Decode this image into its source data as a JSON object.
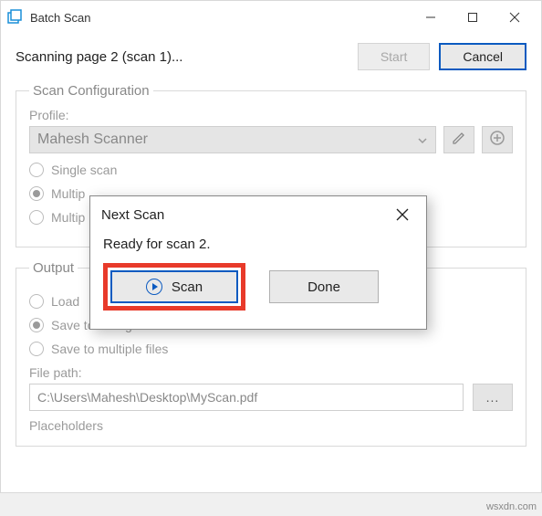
{
  "window": {
    "title": "Batch Scan"
  },
  "status": "Scanning page 2 (scan 1)...",
  "buttons": {
    "start": "Start",
    "cancel": "Cancel"
  },
  "config": {
    "legend": "Scan Configuration",
    "profile_label": "Profile:",
    "profile_value": "Mahesh Scanner",
    "radio_single": "Single scan",
    "radio_multi1": "Multip",
    "radio_multi2": "Multip"
  },
  "output": {
    "legend": "Output",
    "radio_load": "Load",
    "radio_save_single": "Save to a single file",
    "radio_save_multi": "Save to multiple files",
    "filepath_label": "File path:",
    "filepath_value": "C:\\Users\\Mahesh\\Desktop\\MyScan.pdf",
    "browse": "...",
    "placeholders": "Placeholders"
  },
  "dialog": {
    "title": "Next Scan",
    "message": "Ready for scan 2.",
    "scan": "Scan",
    "done": "Done"
  },
  "watermark": "wsxdn.com"
}
